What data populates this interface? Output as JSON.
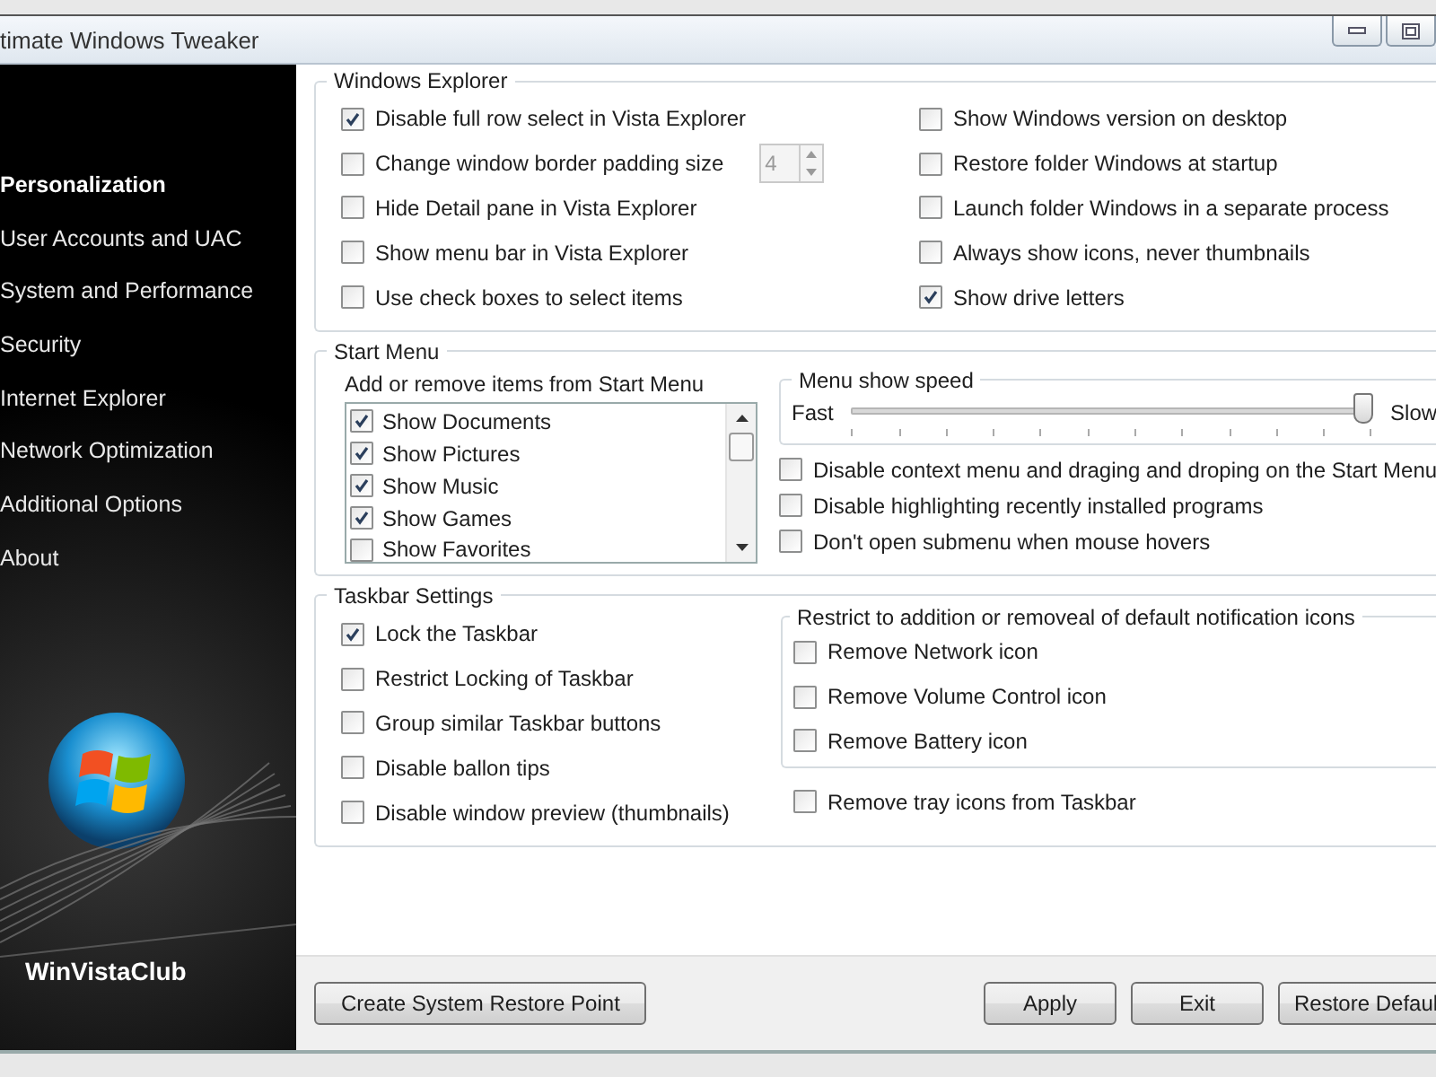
{
  "window": {
    "title": "timate Windows Tweaker"
  },
  "sidebar": {
    "items": [
      {
        "label": "Personalization",
        "selected": true
      },
      {
        "label": "User Accounts and UAC",
        "selected": false
      },
      {
        "label": "System and Performance",
        "selected": false
      },
      {
        "label": "Security",
        "selected": false
      },
      {
        "label": "Internet Explorer",
        "selected": false
      },
      {
        "label": "Network Optimization",
        "selected": false
      },
      {
        "label": "Additional Options",
        "selected": false
      },
      {
        "label": "About",
        "selected": false
      }
    ],
    "brand": "WinVistaClub"
  },
  "windows_explorer": {
    "title": "Windows Explorer",
    "left": [
      {
        "label": "Disable full row select in Vista Explorer",
        "checked": true
      },
      {
        "label": "Change window border padding size",
        "checked": false,
        "spinner": {
          "value": "4",
          "disabled": true
        }
      },
      {
        "label": "Hide Detail pane in Vista Explorer",
        "checked": false
      },
      {
        "label": "Show menu bar in Vista Explorer",
        "checked": false
      },
      {
        "label": "Use check boxes to select items",
        "checked": false
      }
    ],
    "right": [
      {
        "label": "Show Windows version on desktop",
        "checked": false
      },
      {
        "label": "Restore folder Windows at startup",
        "checked": false
      },
      {
        "label": "Launch folder Windows in a separate process",
        "checked": false
      },
      {
        "label": "Always show icons, never thumbnails",
        "checked": false
      },
      {
        "label": "Show drive letters",
        "checked": true
      }
    ]
  },
  "start_menu": {
    "title": "Start Menu",
    "list_title": "Add or remove items from Start Menu",
    "list_items": [
      {
        "label": "Show Documents",
        "checked": true
      },
      {
        "label": "Show Pictures",
        "checked": true
      },
      {
        "label": "Show Music",
        "checked": true
      },
      {
        "label": "Show Games",
        "checked": true
      },
      {
        "label": "Show Favorites",
        "checked": false
      }
    ],
    "speed": {
      "title": "Menu show speed",
      "min_label": "Fast",
      "max_label": "Slow",
      "level": 0.98
    },
    "options": [
      {
        "label": "Disable context menu and draging and droping on the Start Menu",
        "checked": false
      },
      {
        "label": "Disable highlighting recently installed programs",
        "checked": false
      },
      {
        "label": "Don't open submenu when mouse hovers",
        "checked": false
      }
    ]
  },
  "taskbar": {
    "title": "Taskbar Settings",
    "left": [
      {
        "label": "Lock the Taskbar",
        "checked": true
      },
      {
        "label": "Restrict Locking of Taskbar",
        "checked": false
      },
      {
        "label": "Group similar Taskbar buttons",
        "checked": false
      },
      {
        "label": "Disable ballon tips",
        "checked": false
      },
      {
        "label": "Disable window preview (thumbnails)",
        "checked": false
      }
    ],
    "notification": {
      "title": "Restrict to addition or removeal of default notification icons",
      "items": [
        {
          "label": "Remove Network icon",
          "checked": false
        },
        {
          "label": "Remove Volume Control icon",
          "checked": false
        },
        {
          "label": "Remove Battery icon",
          "checked": false
        }
      ]
    },
    "extra": [
      {
        "label": "Remove tray icons from Taskbar",
        "checked": false
      }
    ]
  },
  "buttons": {
    "left": [
      "Create System Restore Point"
    ],
    "right": [
      "Apply",
      "Exit",
      "Restore Defaul"
    ]
  }
}
